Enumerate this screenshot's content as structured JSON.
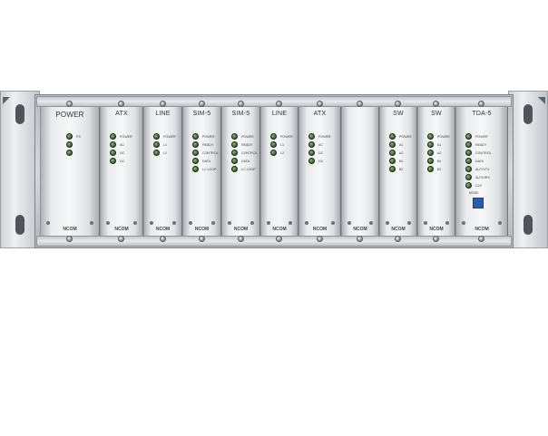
{
  "chassis": {
    "brand": "NCOM",
    "cards": [
      {
        "id": "power",
        "label": "POWER",
        "leds": [
          "FS",
          "",
          ""
        ],
        "brand": "NCOM",
        "variant": "power"
      },
      {
        "id": "atx1",
        "label": "ATX",
        "leds": [
          "POWER",
          "AC",
          "DC",
          "DC"
        ],
        "brand": "NCOM"
      },
      {
        "id": "line1",
        "label": "LINE",
        "leds": [
          "POWER",
          "L1",
          "L2"
        ],
        "brand": "NCOM"
      },
      {
        "id": "sim5a",
        "label": "SIM-5",
        "leds": [
          "POWER",
          "READY",
          "CONTROL",
          "DATA",
          "LC LOOP"
        ],
        "brand": "NCOM"
      },
      {
        "id": "sim5b",
        "label": "SIM-5",
        "leds": [
          "POWER",
          "READY",
          "CONTROL",
          "DATA",
          "LC LOOP"
        ],
        "brand": "NCOM"
      },
      {
        "id": "line2",
        "label": "LINE",
        "leds": [
          "POWER",
          "L1",
          "L2"
        ],
        "brand": "NCOM"
      },
      {
        "id": "atx2",
        "label": "ATX",
        "leds": [
          "POWER",
          "AC",
          "DC",
          "DC"
        ],
        "brand": "NCOM"
      },
      {
        "id": "blank",
        "label": "",
        "leds": [],
        "brand": "NCOM"
      },
      {
        "id": "sw1",
        "label": "SW",
        "leds": [
          "POWER",
          "A1",
          "A2",
          "B1",
          "B2"
        ],
        "brand": "NCOM"
      },
      {
        "id": "sw2",
        "label": "SW",
        "leds": [
          "POWER",
          "A1",
          "A2",
          "B1",
          "B2"
        ],
        "brand": "NCOM"
      },
      {
        "id": "tda5",
        "label": "TDA-5",
        "leds": [
          "POWER",
          "READY",
          "CONTROL",
          "DATA",
          "AUTO/TX",
          "AUTO/RX",
          "CLK"
        ],
        "brand": "NCOM",
        "dip_label": "MODE"
      }
    ]
  },
  "colors": {
    "led_green": "#3f5e33",
    "dip_blue": "#2f5aa8",
    "panel": "#f0f1f2"
  },
  "icons": {
    "screw": "screw-icon",
    "led": "led-indicator-icon",
    "dip": "dip-switch-icon"
  }
}
